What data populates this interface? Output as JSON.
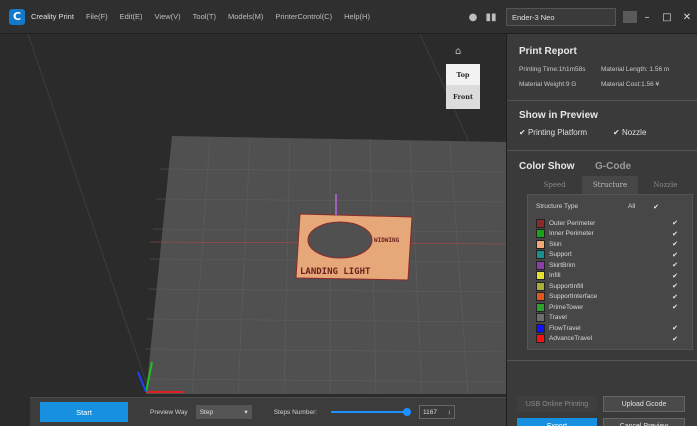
{
  "app": {
    "title": "Creality Print"
  },
  "menu": [
    {
      "label": "File(F)"
    },
    {
      "label": "Edit(E)"
    },
    {
      "label": "View(V)"
    },
    {
      "label": "Tool(T)"
    },
    {
      "label": "Models(M)"
    },
    {
      "label": "PrinterControl(C)"
    },
    {
      "label": "Help(H)"
    }
  ],
  "topbar": {
    "printer": "Ender-3 Neo"
  },
  "viewport": {
    "navcube": {
      "top": "Top",
      "front": "Front"
    },
    "model_text": [
      "LANDING LIGHT",
      "WIDWING"
    ]
  },
  "bottombar": {
    "start": "Start",
    "preview_way_label": "Preview Way",
    "preview_way_value": "Step",
    "steps_label": "Steps Number:",
    "steps_value": "1167",
    "progress": 1.0
  },
  "panel": {
    "print_report": {
      "title": "Print Report",
      "printing_time": "Printing Time:1h1m58s",
      "material_length": "Material Length: 1.56 m",
      "material_weight": "Material Weight:9 G",
      "material_cost": "Material Cost:1.56 ¥"
    },
    "show_preview": {
      "title": "Show in Preview",
      "printing_platform": "Printing Platform",
      "nozzle": "Nozzle"
    },
    "color_show": {
      "title": "Color Show",
      "gcode": "G-Code",
      "tabs": [
        {
          "label": "Speed",
          "active": false
        },
        {
          "label": "Structure",
          "active": true
        },
        {
          "label": "Nozzle",
          "active": false
        }
      ],
      "structure_type_label": "Structure Type",
      "all_label": "All",
      "types": [
        {
          "name": "Outer Perimeter",
          "color": "#8b2a2a",
          "checked": true
        },
        {
          "name": "Inner Perimeter",
          "color": "#1aa31a",
          "checked": true
        },
        {
          "name": "Skin",
          "color": "#f0a878",
          "checked": true
        },
        {
          "name": "Support",
          "color": "#1a8f8f",
          "checked": true
        },
        {
          "name": "SkirtBrim",
          "color": "#8a3fa6",
          "checked": true
        },
        {
          "name": "Infill",
          "color": "#e3e030",
          "checked": true
        },
        {
          "name": "SupportInfill",
          "color": "#a8b03a",
          "checked": true
        },
        {
          "name": "SupportInterface",
          "color": "#e0581e",
          "checked": true
        },
        {
          "name": "PrimeTower",
          "color": "#2ea02e",
          "checked": true
        },
        {
          "name": "Travel",
          "color": "#6d6d6d",
          "checked": false
        },
        {
          "name": "FlowTravel",
          "color": "#1010ff",
          "checked": true
        },
        {
          "name": "AdvanceTravel",
          "color": "#ff1010",
          "checked": true
        }
      ]
    },
    "buttons": {
      "usb_online_printing": "USB Online Printing",
      "upload_gcode": "Upload Gcode",
      "export": "Export",
      "cancel_preview": "Cancel Preview"
    }
  }
}
